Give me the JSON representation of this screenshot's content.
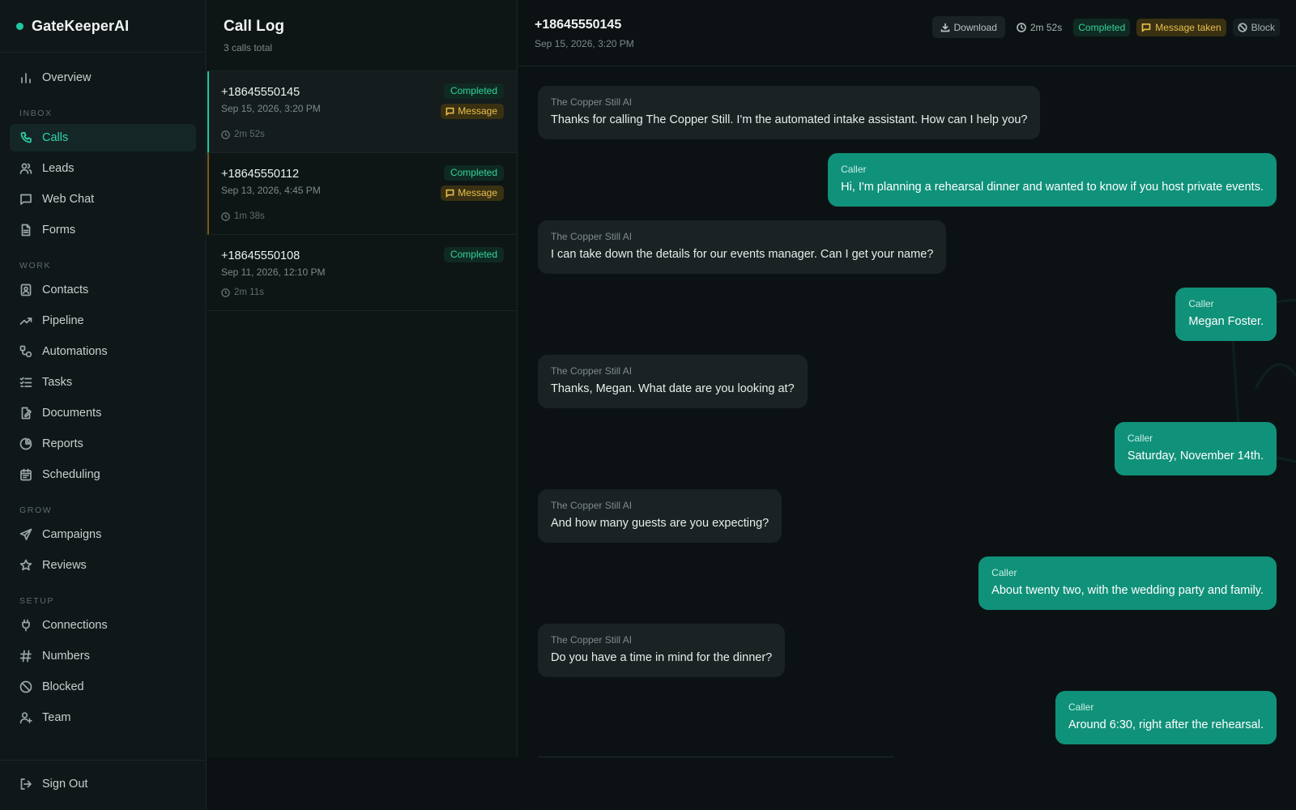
{
  "app": {
    "name": "GateKeeperAI"
  },
  "sidebar": {
    "overview": "Overview",
    "sections": {
      "inbox": "INBOX",
      "work": "WORK",
      "grow": "GROW",
      "setup": "SETUP"
    },
    "inbox_items": [
      {
        "label": "Calls",
        "icon": "phone-icon"
      },
      {
        "label": "Leads",
        "icon": "users-icon"
      },
      {
        "label": "Web Chat",
        "icon": "chat-icon"
      },
      {
        "label": "Forms",
        "icon": "document-icon"
      }
    ],
    "work_items": [
      {
        "label": "Contacts",
        "icon": "contact-card-icon"
      },
      {
        "label": "Pipeline",
        "icon": "trend-icon"
      },
      {
        "label": "Automations",
        "icon": "workflow-icon"
      },
      {
        "label": "Tasks",
        "icon": "checklist-icon"
      },
      {
        "label": "Documents",
        "icon": "file-edit-icon"
      },
      {
        "label": "Reports",
        "icon": "pie-chart-icon"
      },
      {
        "label": "Scheduling",
        "icon": "calendar-icon"
      }
    ],
    "grow_items": [
      {
        "label": "Campaigns",
        "icon": "send-icon"
      },
      {
        "label": "Reviews",
        "icon": "star-icon"
      }
    ],
    "setup_items": [
      {
        "label": "Connections",
        "icon": "plug-icon"
      },
      {
        "label": "Numbers",
        "icon": "hash-icon"
      },
      {
        "label": "Blocked",
        "icon": "ban-icon"
      },
      {
        "label": "Team",
        "icon": "user-plus-icon"
      }
    ],
    "sign_out": "Sign Out"
  },
  "call_log": {
    "title": "Call Log",
    "subtitle": "3 calls total",
    "calls": [
      {
        "number": "+18645550145",
        "date": "Sep 15, 2026, 3:20 PM",
        "duration": "2m 52s",
        "status": "Completed",
        "tag": "Message"
      },
      {
        "number": "+18645550112",
        "date": "Sep 13, 2026, 4:45 PM",
        "duration": "1m 38s",
        "status": "Completed",
        "tag": "Message"
      },
      {
        "number": "+18645550108",
        "date": "Sep 11, 2026, 12:10 PM",
        "duration": "2m 11s",
        "status": "Completed"
      }
    ]
  },
  "detail": {
    "number": "+18645550145",
    "date": "Sep 15, 2026, 3:20 PM",
    "actions": {
      "download": "Download",
      "duration": "2m 52s",
      "status": "Completed",
      "outcome": "Message taken",
      "block": "Block"
    },
    "messages": [
      {
        "speaker": "The Copper Still AI",
        "text": "Thanks for calling The Copper Still. I'm the automated intake assistant. How can I help you?"
      },
      {
        "speaker": "Caller",
        "text": "Hi, I'm planning a rehearsal dinner and wanted to know if you host private events."
      },
      {
        "speaker": "The Copper Still AI",
        "text": "I can take down the details for our events manager. Can I get your name?"
      },
      {
        "speaker": "Caller",
        "text": "Megan Foster."
      },
      {
        "speaker": "The Copper Still AI",
        "text": "Thanks, Megan. What date are you looking at?"
      },
      {
        "speaker": "Caller",
        "text": "Saturday, November 14th."
      },
      {
        "speaker": "The Copper Still AI",
        "text": "And how many guests are you expecting?"
      },
      {
        "speaker": "Caller",
        "text": "About twenty two, with the wedding party and family."
      },
      {
        "speaker": "The Copper Still AI",
        "text": "Do you have a time in mind for the dinner?"
      },
      {
        "speaker": "Caller",
        "text": "Around 6:30, right after the rehearsal."
      }
    ]
  },
  "colors": {
    "accent": "#1fc7a3",
    "caller_bubble": "#10917a",
    "ai_bubble": "#1b2223",
    "status_green": "#34d39a",
    "status_amber": "#e8c04b"
  }
}
